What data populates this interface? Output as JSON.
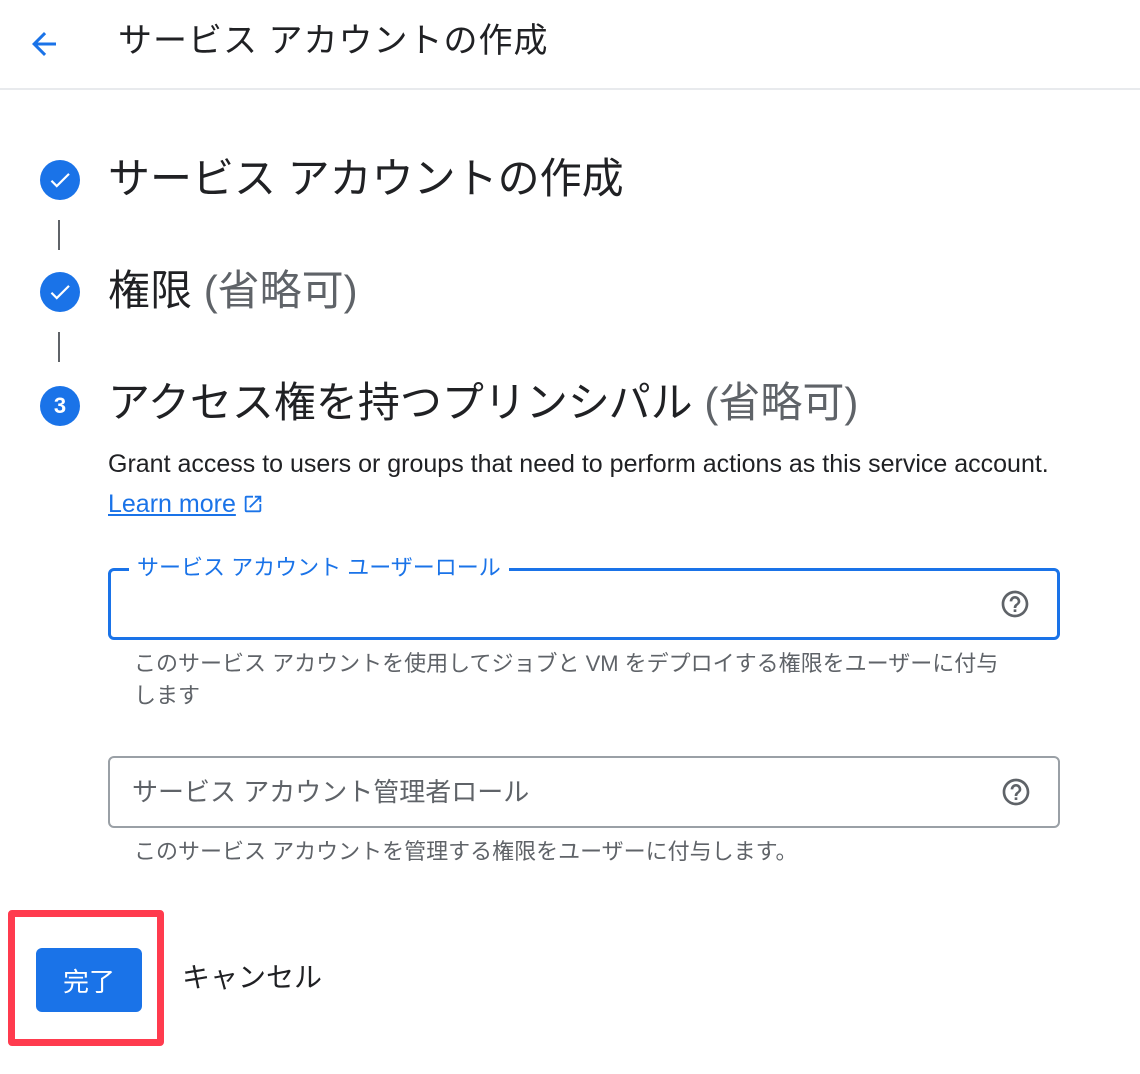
{
  "header": {
    "title": "サービス アカウントの作成",
    "back_icon": "arrow-back-icon"
  },
  "steps": [
    {
      "title": "サービス アカウントの作成",
      "optional": "",
      "status": "completed",
      "icon": "check-icon"
    },
    {
      "title": "権限",
      "optional": "(省略可)",
      "status": "completed",
      "icon": "check-icon"
    },
    {
      "title": "アクセス権を持つプリンシパル",
      "optional": "(省略可)",
      "status": "active",
      "number": "3"
    }
  ],
  "step3": {
    "description": "Grant access to users or groups that need to perform actions as this service account.",
    "learn_more": "Learn more",
    "fields": [
      {
        "label": "サービス アカウント ユーザーロール",
        "value": "",
        "focused": true,
        "hint": "このサービス アカウントを使用してジョブと VM をデプロイする権限をユーザーに付与します"
      },
      {
        "label": "サービス アカウント管理者ロール",
        "value": "",
        "focused": false,
        "hint": "このサービス アカウントを管理する権限をユーザーに付与します。"
      }
    ]
  },
  "actions": {
    "done_label": "完了",
    "cancel_label": "キャンセル"
  },
  "colors": {
    "accent": "#1a73e8",
    "highlight": "#ff3b4e",
    "text": "#202124",
    "secondary_text": "#5f6368"
  }
}
